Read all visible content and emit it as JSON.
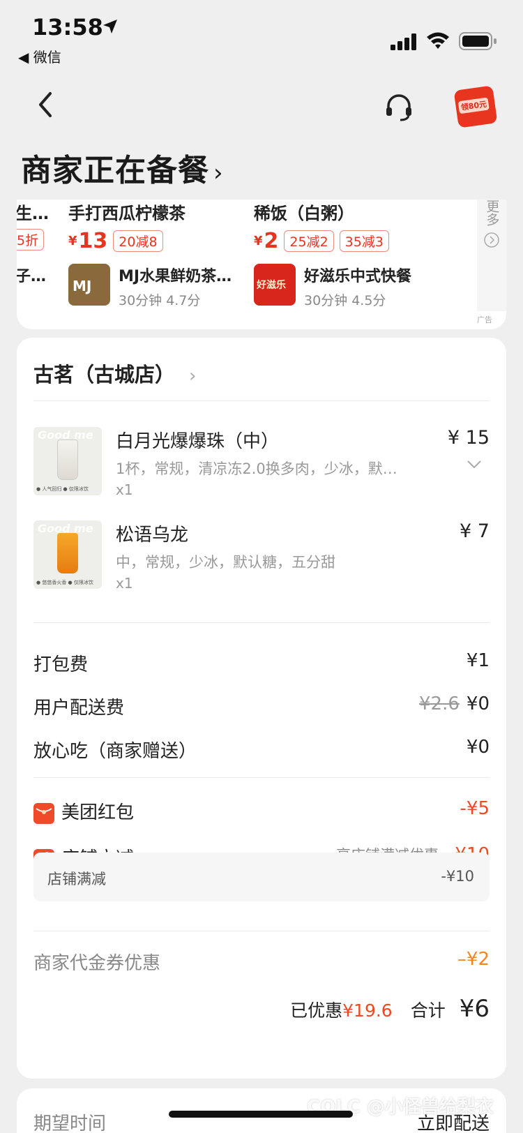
{
  "status_bar": {
    "time": "13:58",
    "back_app": "◀ 微信"
  },
  "header": {
    "title": "商家正在备餐",
    "promo_tag": "领80元"
  },
  "recommend": {
    "items": [
      {
        "name": "生…",
        "chip": "5折",
        "store_name": "子…"
      },
      {
        "name": "手打西瓜柠檬茶",
        "price": "13",
        "chips": [
          "20减8"
        ],
        "store_name": "MJ水果鲜奶茶…",
        "store_meta": "30分钟  4.7分",
        "logo_text": "MJ"
      },
      {
        "name": "稀饭（白粥）",
        "price": "2",
        "chips": [
          "25减2",
          "35减3"
        ],
        "store_name": "好滋乐中式快餐",
        "store_meta": "30分钟  4.5分",
        "logo_text": "好滋乐"
      }
    ],
    "more": "更多",
    "ad_mark": "广告",
    "yen": "¥"
  },
  "order": {
    "shop_name": "古茗（古城店）",
    "items": [
      {
        "name": "白月光爆爆珠（中）",
        "spec": "1杯，常规，清凉冻2.0换多肉，少冰，默…",
        "qty": "x1",
        "price": "¥ 15",
        "thumb_text": "Good me",
        "thumb_foot": "● 人气回归  ● 仅限冰饮"
      },
      {
        "name": "松语乌龙",
        "spec": "中，常规，少冰，默认糖，五分甜",
        "qty": "x1",
        "price": "¥ 7",
        "thumb_text": "Good me",
        "thumb_foot": "● 悠悠香火香  ● 仅限冰饮"
      }
    ],
    "fees": [
      {
        "label": "打包费",
        "value": "¥1"
      },
      {
        "label": "用户配送费",
        "original": "¥2.6",
        "value": "¥0"
      },
      {
        "label": "放心吃（商家赠送）",
        "value": "¥0"
      }
    ],
    "discounts": [
      {
        "label": "美团红包",
        "value": "-¥5",
        "icon": "red-packet-icon"
      },
      {
        "label": "店铺立减",
        "note": "享店铺满减优惠",
        "value": "-¥10",
        "icon_text": "减"
      }
    ],
    "sub_discount": {
      "label": "店铺满减",
      "value": "-¥10"
    },
    "voucher": {
      "label": "商家代金券优惠",
      "value": "–¥2"
    },
    "total": {
      "saved_label": "已优惠",
      "saved_value": "¥19.6",
      "total_label": "合计",
      "total_value": "¥6"
    }
  },
  "delivery": {
    "label": "期望时间",
    "value": "立即配送"
  },
  "watermark": "COLC @小怪兽给梨衣",
  "colors": {
    "accent_red": "#ee4a22",
    "voucher_orange": "#f2851f",
    "background": "#efefef"
  }
}
